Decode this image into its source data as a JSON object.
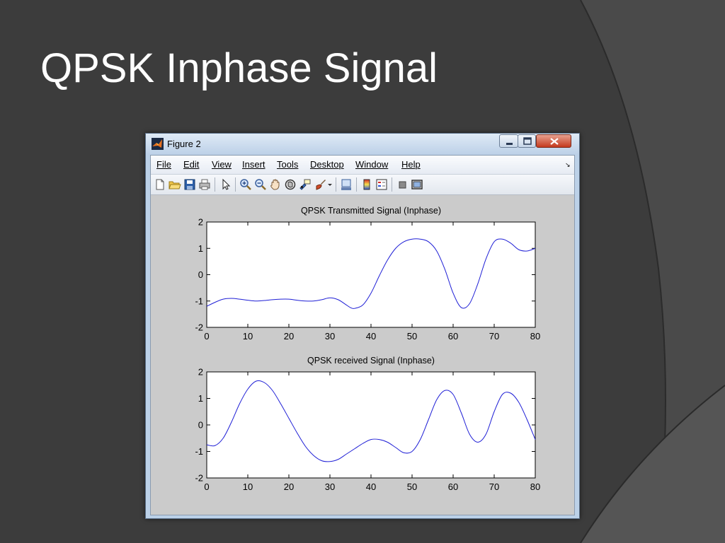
{
  "slide": {
    "title": "QPSK Inphase Signal"
  },
  "window": {
    "title": "Figure 2",
    "menu": [
      "File",
      "Edit",
      "View",
      "Insert",
      "Tools",
      "Desktop",
      "Window",
      "Help"
    ],
    "toolbar_icons": [
      "new-figure-icon",
      "open-file-icon",
      "save-icon",
      "print-icon",
      "pointer-icon",
      "zoom-in-icon",
      "zoom-out-icon",
      "pan-icon",
      "rotate-3d-icon",
      "data-cursor-icon",
      "brush-icon",
      "brush-dropdown-icon",
      "link-plot-icon",
      "colorbar-icon",
      "legend-icon",
      "hide-plot-tools-icon",
      "show-plot-tools-icon"
    ]
  },
  "colors": {
    "slide_background": "#3c3c3c",
    "figure_background": "#cbcbcb",
    "plot_line": "#1f1fd6"
  },
  "chart_data": [
    {
      "type": "line",
      "title": "QPSK Transmitted Signal (Inphase)",
      "xlabel": "",
      "ylabel": "",
      "xlim": [
        0,
        80
      ],
      "ylim": [
        -2,
        2
      ],
      "xticks": [
        0,
        10,
        20,
        30,
        40,
        50,
        60,
        70,
        80
      ],
      "yticks": [
        -2,
        -1,
        0,
        1,
        2
      ],
      "x": [
        0,
        2,
        4,
        6,
        8,
        10,
        12,
        14,
        16,
        18,
        20,
        22,
        24,
        26,
        28,
        30,
        32,
        34,
        35,
        36,
        38,
        40,
        42,
        44,
        46,
        48,
        50,
        52,
        54,
        56,
        58,
        60,
        62,
        64,
        66,
        68,
        70,
        72,
        74,
        76,
        78,
        80
      ],
      "series": [
        {
          "values": [
            -1.2,
            -1.05,
            -0.93,
            -0.9,
            -0.93,
            -0.97,
            -1.0,
            -0.98,
            -0.95,
            -0.93,
            -0.93,
            -0.97,
            -1.0,
            -1.0,
            -0.95,
            -0.88,
            -0.95,
            -1.15,
            -1.25,
            -1.28,
            -1.15,
            -0.7,
            -0.05,
            0.55,
            1.0,
            1.25,
            1.35,
            1.35,
            1.25,
            0.9,
            0.2,
            -0.7,
            -1.25,
            -1.1,
            -0.35,
            0.6,
            1.25,
            1.35,
            1.2,
            0.95,
            0.9,
            1.0
          ]
        }
      ]
    },
    {
      "type": "line",
      "title": "QPSK received Signal (Inphase)",
      "xlabel": "",
      "ylabel": "",
      "xlim": [
        0,
        80
      ],
      "ylim": [
        -2,
        2
      ],
      "xticks": [
        0,
        10,
        20,
        30,
        40,
        50,
        60,
        70,
        80
      ],
      "yticks": [
        -2,
        -1,
        0,
        1,
        2
      ],
      "x": [
        0,
        2,
        4,
        6,
        8,
        10,
        12,
        14,
        16,
        18,
        20,
        22,
        24,
        26,
        28,
        30,
        32,
        34,
        36,
        38,
        40,
        42,
        44,
        46,
        48,
        50,
        52,
        54,
        56,
        58,
        60,
        62,
        64,
        66,
        68,
        70,
        72,
        74,
        76,
        78,
        80
      ],
      "series": [
        {
          "values": [
            -0.75,
            -0.78,
            -0.5,
            0.1,
            0.8,
            1.35,
            1.65,
            1.6,
            1.3,
            0.8,
            0.25,
            -0.3,
            -0.8,
            -1.15,
            -1.35,
            -1.38,
            -1.3,
            -1.1,
            -0.9,
            -0.7,
            -0.55,
            -0.55,
            -0.65,
            -0.85,
            -1.05,
            -1.0,
            -0.55,
            0.2,
            0.95,
            1.3,
            1.15,
            0.45,
            -0.35,
            -0.65,
            -0.35,
            0.5,
            1.15,
            1.2,
            0.85,
            0.2,
            -0.55
          ]
        }
      ]
    }
  ]
}
